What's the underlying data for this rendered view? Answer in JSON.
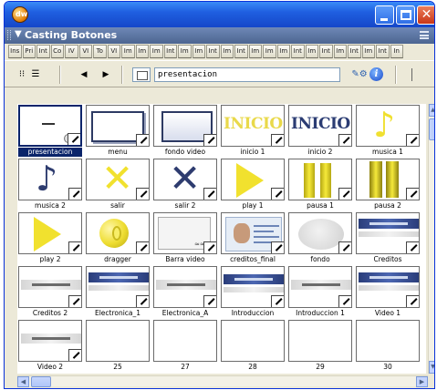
{
  "window": {
    "app_icon": "dw-logo-icon",
    "app_icon_text": "dw",
    "buttons": [
      "minimize",
      "maximize",
      "close"
    ],
    "colors": {
      "titlebar": "#1f5fe0",
      "close": "#c93617",
      "panel_header": "#5a74a2"
    }
  },
  "panel": {
    "title": "Casting Botones",
    "collapse_glyph": "▼"
  },
  "tabs": [
    "Ins",
    "Pri",
    "Int",
    "Co",
    "IV",
    "VI",
    "To",
    "VI",
    "Im",
    "Im",
    "Im",
    "Int",
    "Im",
    "Im",
    "Int",
    "Im",
    "Int",
    "Im",
    "Im",
    "Im",
    "Int",
    "Im",
    "Int",
    "Im",
    "Int",
    "Im",
    "Int",
    "In"
  ],
  "toolbar": {
    "thumbs_glyph": "⁝⁝",
    "list_glyph": "☰",
    "back_glyph": "◀",
    "forward_glyph": "▶",
    "member_name": "presentacion",
    "cast_glyph": "✎⚙",
    "info_glyph": "i"
  },
  "scroll": {
    "up": "▲",
    "down": "▼",
    "left": "◀",
    "right": "▶"
  },
  "cast_members": [
    {
      "label": "presentacion",
      "art": "dash",
      "selected": true
    },
    {
      "label": "menu",
      "art": "frame"
    },
    {
      "label": "fondo video",
      "art": "frame-fill"
    },
    {
      "label": "inicio 1",
      "art": "inicio-gold",
      "text": "INICIO"
    },
    {
      "label": "inicio 2",
      "art": "inicio-blue",
      "text": "INICIO"
    },
    {
      "label": "musica 1",
      "art": "note-yellow",
      "text": "♪"
    },
    {
      "label": "musica 2",
      "art": "note-navy",
      "text": "♪"
    },
    {
      "label": "salir",
      "art": "x-yellow",
      "text": "✕"
    },
    {
      "label": "salir 2",
      "art": "x-navy",
      "text": "✕"
    },
    {
      "label": "play 1",
      "art": "triangle"
    },
    {
      "label": "pausa 1",
      "art": "bars"
    },
    {
      "label": "pausa 2",
      "art": "bars-dark"
    },
    {
      "label": "play 2",
      "art": "triangle"
    },
    {
      "label": "dragger",
      "art": "ball"
    },
    {
      "label": "Barra video",
      "art": "clip",
      "text": "≈≈"
    },
    {
      "label": "creditos_final",
      "art": "photo"
    },
    {
      "label": "fondo",
      "art": "bubble"
    },
    {
      "label": "Creditos",
      "art": "band-top"
    },
    {
      "label": "Creditos 2",
      "art": "band-light"
    },
    {
      "label": "Electronica_1",
      "art": "band-top"
    },
    {
      "label": "Electronica_A",
      "art": "band-light"
    },
    {
      "label": "Introduccion",
      "art": "band-mid"
    },
    {
      "label": "Introduccion 1",
      "art": "band-light"
    },
    {
      "label": "Video 1",
      "art": "band-top"
    },
    {
      "label": "Video 2",
      "art": "band-light"
    },
    {
      "label": "25",
      "art": "empty"
    },
    {
      "label": "27",
      "art": "empty"
    },
    {
      "label": "28",
      "art": "empty"
    },
    {
      "label": "29",
      "art": "empty"
    },
    {
      "label": "30",
      "art": "empty"
    }
  ]
}
